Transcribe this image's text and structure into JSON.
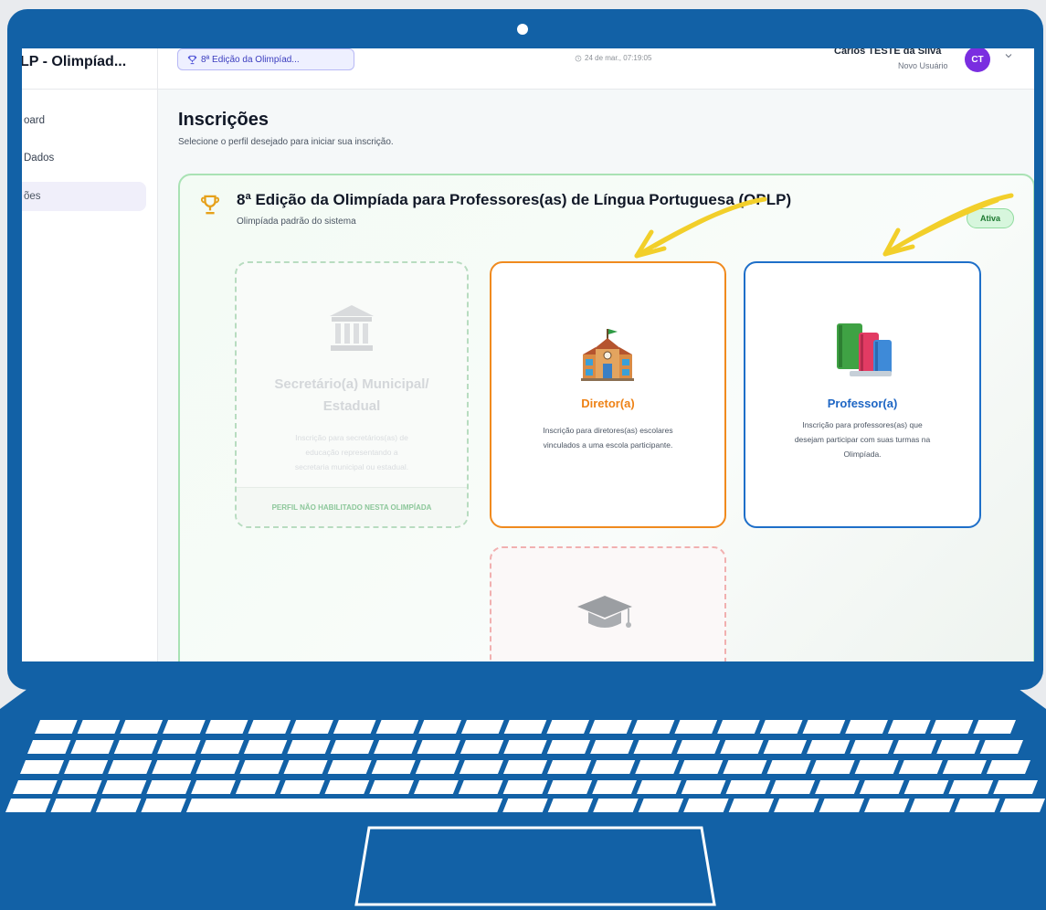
{
  "app": {
    "brand": "LP - Olimpíad...",
    "sidebar": {
      "items": [
        {
          "label": "oard",
          "active": false
        },
        {
          "label": "Dados",
          "active": false
        },
        {
          "label": "ões",
          "active": true
        }
      ]
    },
    "header": {
      "edition_pill": "8ª Edição da Olimpíad...",
      "clock": "24 de mar., 07:19:05",
      "user_name": "Carlos TESTE da Silva",
      "user_role": "Novo Usuário",
      "avatar_initials": "CT"
    },
    "main": {
      "title": "Inscrições",
      "subtitle": "Selecione o perfil desejado para iniciar sua inscrição.",
      "olympiad": {
        "title": "8ª Edição da Olimpíada para Professores(as) de Língua Portuguesa (OPLP)",
        "subtitle": "Olimpíada padrão do sistema",
        "status_badge": "Ativa"
      },
      "profiles": {
        "secretary": {
          "title_line1": "Secretário(a) Municipal/",
          "title_line2": "Estadual",
          "desc_line1": "Inscrição para secretários(as) de",
          "desc_line2": "educação representando a",
          "desc_line3": "secretaria municipal ou estadual.",
          "footer": "PERFIL NÃO HABILITADO NESTA OLIMPÍADA"
        },
        "director": {
          "title": "Diretor(a)",
          "desc_line1": "Inscrição para diretores(as) escolares",
          "desc_line2": "vinculados a uma escola participante."
        },
        "teacher": {
          "title": "Professor(a)",
          "desc_line1": "Inscrição para professores(as) que",
          "desc_line2": "desejam participar com suas turmas na",
          "desc_line3": "Olimpíada."
        }
      }
    }
  },
  "colors": {
    "laptop": "#1261a6",
    "director_accent": "#f08a1e",
    "teacher_accent": "#1e6fc9",
    "active_badge": "#d7f6dd",
    "annotation_arrow": "#f2cf2a"
  }
}
